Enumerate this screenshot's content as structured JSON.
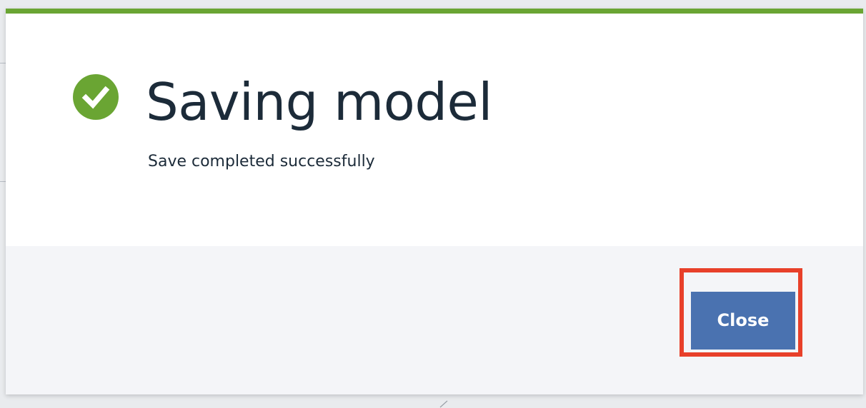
{
  "dialog": {
    "title": "Saving model",
    "message": "Save completed successfully",
    "status_icon": "check-circle-icon",
    "status": "success",
    "close_label": "Close"
  },
  "colors": {
    "accent": "#6aa533",
    "primary_button": "#4a72b0",
    "highlight": "#e8402a",
    "text": "#1c2b39",
    "footer_bg": "#f4f5f8"
  }
}
